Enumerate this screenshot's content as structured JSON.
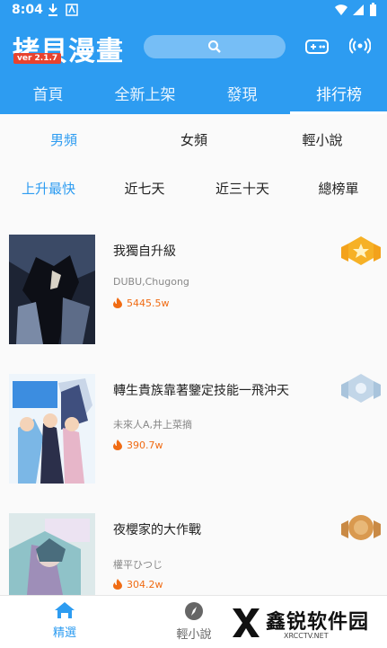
{
  "status_bar": {
    "time": "8:04"
  },
  "app": {
    "title": "拷貝漫畫",
    "version": "ver 2.1.7"
  },
  "header_tabs": [
    "首頁",
    "全新上架",
    "發現",
    "排行榜"
  ],
  "gender_filters": [
    "男頻",
    "女頻",
    "輕小說"
  ],
  "period_filters": [
    "上升最快",
    "近七天",
    "近三十天",
    "總榜單"
  ],
  "rankings": [
    {
      "title": "我獨自升級",
      "author": "DUBU,Chugong",
      "heat": "5445.5w",
      "medal": "gold"
    },
    {
      "title": "轉生貴族靠著鑒定技能一飛沖天",
      "author": "未來人A,井上菜摘",
      "heat": "390.7w",
      "medal": "silver"
    },
    {
      "title": "夜櫻家的大作戰",
      "author": "權平ひつじ",
      "heat": "304.2w",
      "medal": "bronze"
    }
  ],
  "bottom_nav": [
    "精選",
    "輕小說"
  ],
  "watermark": {
    "text": "鑫锐软件园",
    "sub": "XRCCTV.NET"
  },
  "colors": {
    "primary": "#2d9cf1",
    "heat": "#f06b13"
  }
}
